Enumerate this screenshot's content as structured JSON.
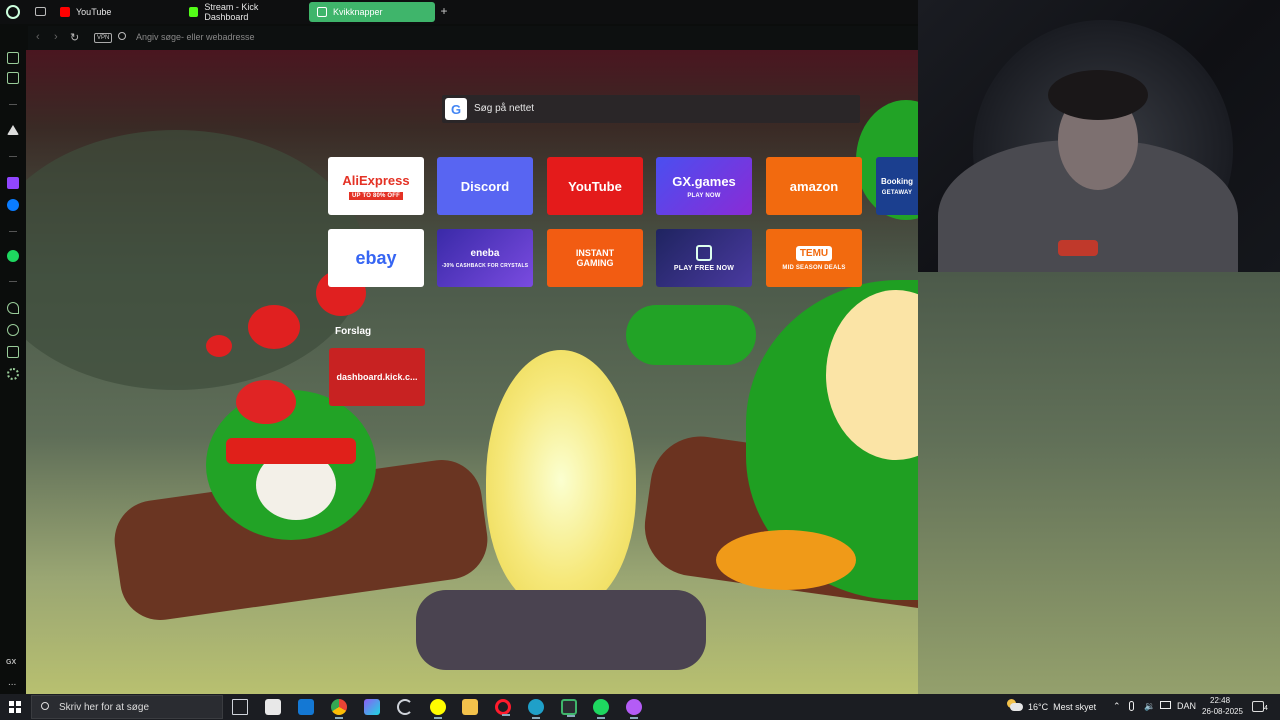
{
  "tabs": [
    {
      "label": "YouTube",
      "active": false,
      "favicon_color": "#ff0000"
    },
    {
      "label": "Stream - Kick Dashboard",
      "active": false,
      "favicon_color": "#53fc18"
    },
    {
      "label": "Kvikknapper",
      "active": true,
      "favicon_color": "#ffffff"
    }
  ],
  "address_bar": {
    "vpn_label": "VPN",
    "placeholder": "Angiv søge- eller webadresse"
  },
  "sidebar": {
    "gx_label": "GX",
    "more_label": "..."
  },
  "search": {
    "google_glyph": "G",
    "label": "Søg på nettet"
  },
  "speed_dial": [
    {
      "name": "aliexpress",
      "label": "AliExpress",
      "sub": "UP TO 80% OFF",
      "bg": "#ffffff",
      "fg": "#e43225"
    },
    {
      "name": "discord",
      "label": "Discord",
      "sub": "",
      "bg": "#5865f2",
      "fg": "#ffffff"
    },
    {
      "name": "youtube",
      "label": "YouTube",
      "sub": "",
      "bg": "#e41b1b",
      "fg": "#ffffff"
    },
    {
      "name": "gx-games",
      "label": "GX.games",
      "sub": "PLAY NOW",
      "bg": "#6a3fd6",
      "fg": "#ffffff"
    },
    {
      "name": "amazon",
      "label": "amazon",
      "sub": "",
      "bg": "#f26a0f",
      "fg": "#ffffff"
    },
    {
      "name": "booking",
      "label": "Booking",
      "sub": "GETAWAY",
      "bg": "#1b3f8f",
      "fg": "#ffffff"
    },
    {
      "name": "ebay",
      "label": "ebay",
      "sub": "",
      "bg": "#ffffff",
      "fg": "#3665f3"
    },
    {
      "name": "eneba",
      "label": "eneba",
      "sub": "-30% CASHBACK FOR CRYSTALS",
      "bg": "#3a2aa8",
      "fg": "#ffffff"
    },
    {
      "name": "instant-gaming",
      "label": "INSTANT GAMING",
      "sub": "",
      "bg": "#f25c12",
      "fg": "#ffffff"
    },
    {
      "name": "world-of-warships",
      "label": "PLAY FREE NOW",
      "sub": "",
      "bg": "#2a2566",
      "fg": "#ffffff"
    },
    {
      "name": "temu",
      "label": "TEMU",
      "sub": "MID SEASON DEALS",
      "bg": "#f26a0f",
      "fg": "#ffffff"
    }
  ],
  "suggestions": {
    "heading": "Forslag",
    "items": [
      {
        "label": "dashboard.kick.c..."
      }
    ]
  },
  "taskbar": {
    "search_placeholder": "Skriv her for at søge",
    "apps": [
      {
        "name": "task-view",
        "color": "#cfd3da"
      },
      {
        "name": "microsoft-store",
        "color": "#e8e8e8"
      },
      {
        "name": "outlook",
        "color": "#1478d4"
      },
      {
        "name": "chrome",
        "color": "#e8b024"
      },
      {
        "name": "multicolor-app",
        "color": "#8d5cf6"
      },
      {
        "name": "g-app",
        "color": "#cfd3da"
      },
      {
        "name": "snapchat",
        "color": "#fffc00"
      },
      {
        "name": "file-explorer",
        "color": "#f2c14b"
      },
      {
        "name": "opera",
        "color": "#ff1b2d"
      },
      {
        "name": "edge",
        "color": "#1fa0c9"
      },
      {
        "name": "opera-gx",
        "color": "#3fb56b"
      },
      {
        "name": "spotify",
        "color": "#1ed760"
      },
      {
        "name": "streaming-app",
        "color": "#b45cf6"
      }
    ],
    "weather": {
      "temp": "16°C",
      "desc": "Mest skyet"
    },
    "language": "DAN",
    "time": "22:48",
    "date": "26-08-2025",
    "notifications": "4"
  }
}
